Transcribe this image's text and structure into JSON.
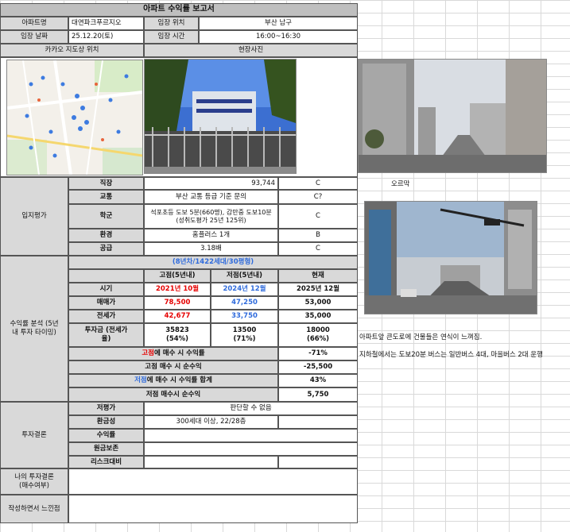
{
  "title": "아파트 수익률 보고서",
  "info": {
    "apt_label": "아파트명",
    "apt_value": "대연파크푸르지오",
    "loc_label": "임장 위치",
    "loc_value": "부산 남구",
    "date_label": "임장 날짜",
    "date_value": "25.12.20(토)",
    "time_label": "임장 시간",
    "time_value": "16:00~16:30",
    "map_label": "카카오 지도상 위치",
    "photo_label": "현장사진"
  },
  "location_eval": {
    "section_label": "입지평가",
    "rows": [
      {
        "label": "직장",
        "value": "93,744",
        "grade": "C"
      },
      {
        "label": "교통",
        "value": "부산 교통 등급 기준 문의",
        "grade": "C?"
      },
      {
        "label": "학군",
        "value": "석포초등 도보 5분(660명), 감만중 도보10분(성취도평가 25년 125위)",
        "grade": "C"
      },
      {
        "label": "환경",
        "value": "홈플러스 1개",
        "grade": "B"
      },
      {
        "label": "공급",
        "value": "3.18배",
        "grade": "C"
      }
    ]
  },
  "profit": {
    "section_label": "수익률 분석 (5년 내 투자 타이밍)",
    "subtitle": "(8년차/1422세대/30평형)",
    "headers": [
      "고점(5년내)",
      "저점(5년내)",
      "현재"
    ],
    "rows": [
      {
        "label": "시기",
        "values": [
          "2021년 10월",
          "2024년 12월",
          "2025년 12월"
        ]
      },
      {
        "label": "매매가",
        "values": [
          "78,500",
          "47,250",
          "53,000"
        ]
      },
      {
        "label": "전세가",
        "values": [
          "42,677",
          "33,750",
          "35,000"
        ]
      },
      {
        "label": "투자금 (전세가율)",
        "values": [
          "35823 (54%)",
          "13500 (71%)",
          "18000 (66%)"
        ]
      }
    ],
    "summary": [
      {
        "label_a": "고점",
        "label_b": "에 매수 시 수익률",
        "value": "-71%"
      },
      {
        "label_a": "",
        "label_b": "고점 매수 시 순수익",
        "value": "-25,500"
      },
      {
        "label_a": "저점",
        "label_b": "에 매수 시 수익률 합계",
        "value": "43%"
      },
      {
        "label_a": "",
        "label_b": "저점 매수시 순수익",
        "value": "5,750"
      }
    ]
  },
  "conclusion": {
    "section_label": "투자결론",
    "rows": [
      {
        "label": "저평가",
        "value": "판단할 수 없음"
      },
      {
        "label": "환금성",
        "value": "300세대 이상, 22/28층"
      },
      {
        "label": "수익률",
        "value": ""
      },
      {
        "label": "원금보존",
        "value": ""
      },
      {
        "label": "리스크대비",
        "value": ""
      }
    ]
  },
  "my_conclusion_label": "나의 투자결론 (매수여부)",
  "notes_label": "작성하면서 느낀점",
  "side_notes": {
    "uphill": "오르막",
    "note1": "아파트앞 큰도로에 건물들은 연식이 느껴짐.",
    "note2": "지하철에서는 도보20분 버스는 일반버스 4대, 마을버스 2대 운행"
  },
  "colors": {
    "label_bg": "#d9d9d9",
    "high": "#e60000",
    "low": "#2f6bdc",
    "title_bg": "#bfbfbf"
  }
}
